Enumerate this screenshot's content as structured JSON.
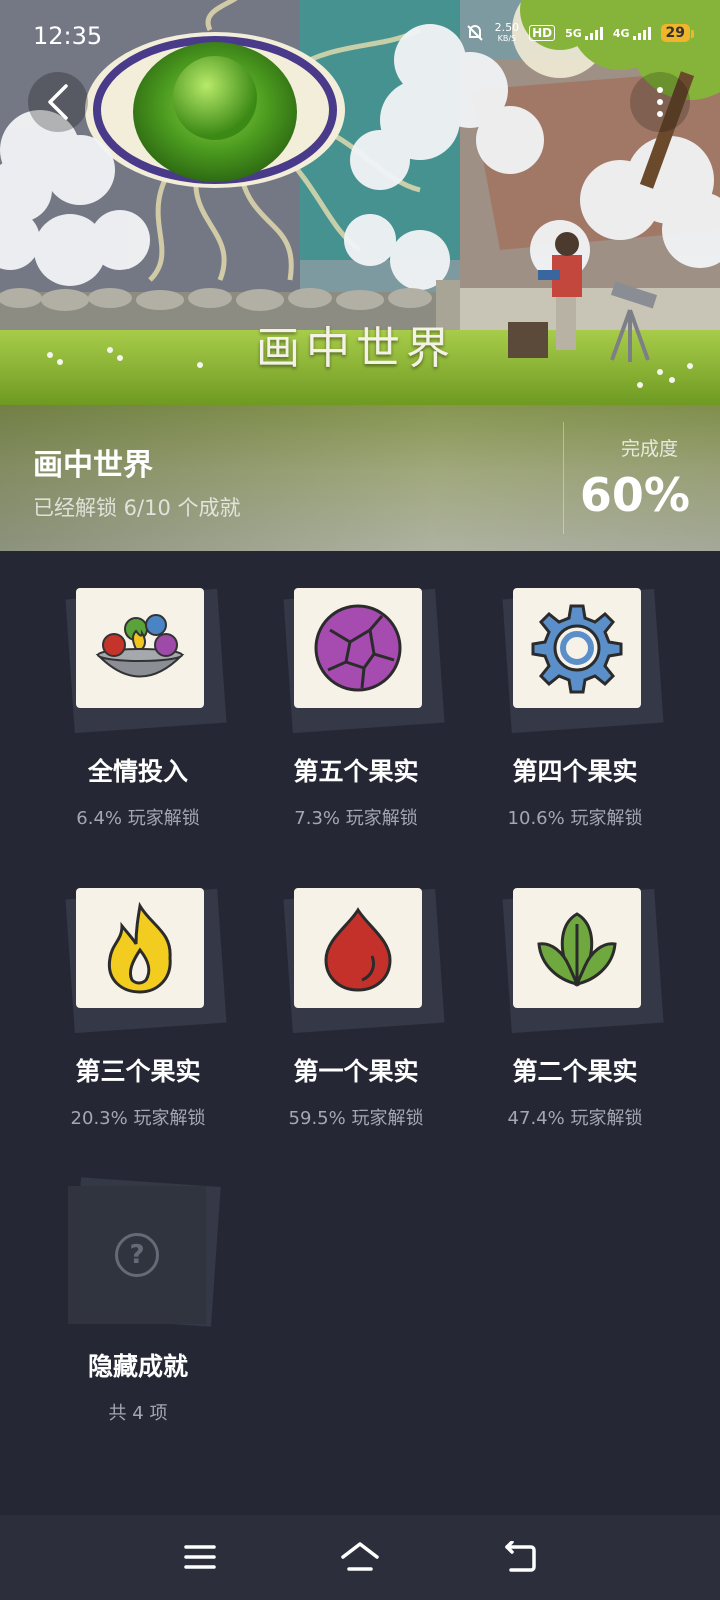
{
  "status_bar": {
    "time": "12:35",
    "net_speed": "2.50",
    "net_unit": "KB/S",
    "hd": "HD",
    "sim1": "5G",
    "sim2": "4G",
    "battery": "29"
  },
  "hero": {
    "banner_title": "画中世界"
  },
  "summary": {
    "game_name": "画中世界",
    "unlock_text": "已经解锁 6/10 个成就",
    "completion_label": "完成度",
    "completion_value": "60%",
    "completion_fraction": 0.6
  },
  "achievements": [
    {
      "name": "全情投入",
      "rate": "6.4% 玩家解锁",
      "icon": "fruit-bowl-icon"
    },
    {
      "name": "第五个果实",
      "rate": "7.3% 玩家解锁",
      "icon": "purple-fruit-icon"
    },
    {
      "name": "第四个果实",
      "rate": "10.6% 玩家解锁",
      "icon": "blue-gear-icon"
    },
    {
      "name": "第三个果实",
      "rate": "20.3% 玩家解锁",
      "icon": "yellow-flame-icon"
    },
    {
      "name": "第一个果实",
      "rate": "59.5% 玩家解锁",
      "icon": "red-drop-icon"
    },
    {
      "name": "第二个果实",
      "rate": "47.4% 玩家解锁",
      "icon": "green-leaf-icon"
    }
  ],
  "hidden": {
    "name": "隐藏成就",
    "count": "共 4 项",
    "icon": "question-mark-icon"
  },
  "colors": {
    "page_bg": "#252834",
    "card_bg": "#f6f2e8",
    "rate_text": "#a4a7b1",
    "battery": "#f0b52a"
  }
}
